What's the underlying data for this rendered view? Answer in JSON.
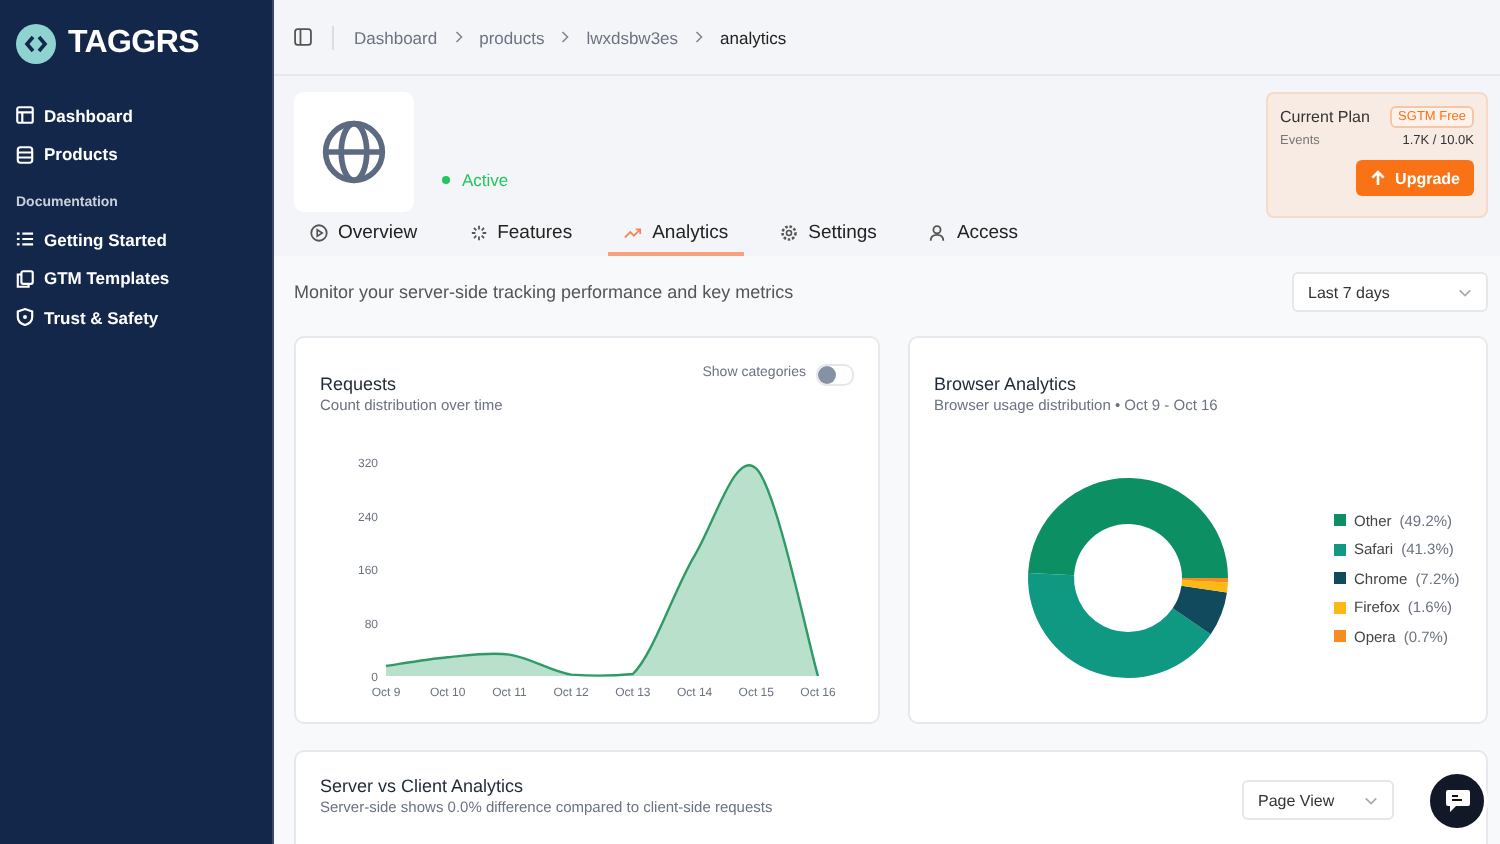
{
  "sidebar": {
    "brand": "TAGGRS",
    "items": [
      {
        "label": "Dashboard",
        "selected": false
      },
      {
        "label": "Products",
        "selected": false
      }
    ],
    "section_title": "Documentation",
    "doc_items": [
      {
        "label": "Getting Started"
      },
      {
        "label": "GTM Templates"
      },
      {
        "label": "Trust & Safety"
      }
    ]
  },
  "breadcrumbs": [
    "Dashboard",
    "products",
    "lwxdsbw3es",
    "analytics"
  ],
  "product": {
    "status": "Active"
  },
  "plan": {
    "title": "Current Plan",
    "badge": "SGTM Free",
    "events_label": "Events",
    "events_value": "1.7K / 10.0K",
    "button": "Upgrade"
  },
  "tabs": [
    {
      "label": "Overview",
      "selected": false
    },
    {
      "label": "Features",
      "selected": false
    },
    {
      "label": "Analytics",
      "selected": true
    },
    {
      "label": "Settings",
      "selected": false
    },
    {
      "label": "Access",
      "selected": false
    }
  ],
  "intro": "Monitor your server-side tracking performance and key metrics",
  "range": {
    "value": "Last 7 days"
  },
  "requests": {
    "title": "Requests",
    "subtitle": "Count distribution over time",
    "toggle_label": "Show categories",
    "on": false,
    "chart_data": {
      "type": "area",
      "x": [
        "Oct 9",
        "Oct 10",
        "Oct 11",
        "Oct 12",
        "Oct 13",
        "Oct 14",
        "Oct 15",
        "Oct 16"
      ],
      "ylim": [
        0,
        320
      ],
      "yticks": [
        0,
        80,
        160,
        240,
        320
      ],
      "series": [
        {
          "color": "#2e9a66",
          "values": [
            15,
            28,
            32,
            2,
            3,
            180,
            310,
            0
          ]
        }
      ]
    }
  },
  "browsers": {
    "title": "Browser Analytics",
    "subtitle": "Browser usage distribution • Oct 9 - Oct 16",
    "chart_data": {
      "type": "donut",
      "categories": [
        "Other",
        "Safari",
        "Chrome",
        "Firefox",
        "Opera"
      ],
      "values": [
        49.2,
        41.3,
        7.2,
        1.6,
        0.7
      ]
    },
    "legend": [
      {
        "percent": "(49.2%)",
        "color": "#0c8f62"
      },
      {
        "percent": "(41.3%)",
        "color": "#0f9882"
      },
      {
        "percent": "(7.2%)",
        "color": "#114a5c"
      },
      {
        "percent": "(1.6%)",
        "color": "#fdb913"
      },
      {
        "percent": "(0.7%)",
        "color": "#f68b1f"
      }
    ]
  },
  "server_client": {
    "title": "Server vs Client Analytics",
    "subtitle": "Server-side shows 0.0% difference compared to client-side requests",
    "select": "Page View"
  }
}
